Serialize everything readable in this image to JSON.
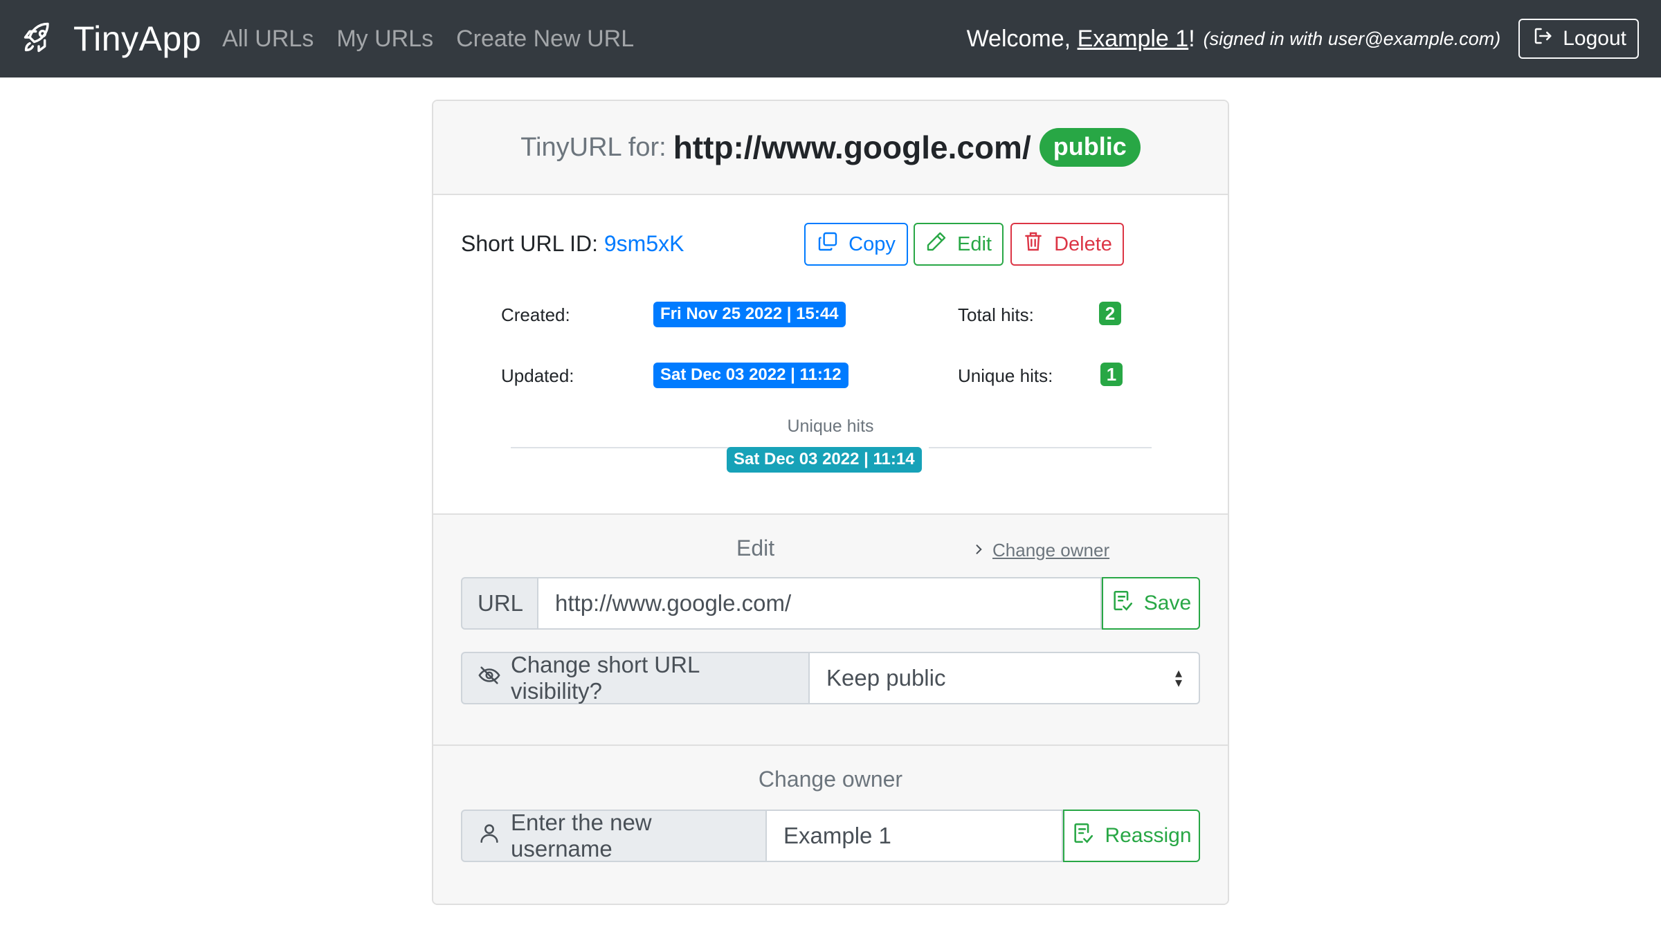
{
  "navbar": {
    "brand": "TinyApp",
    "brand_icon": "rocket-icon",
    "links": [
      "All URLs",
      "My URLs",
      "Create New URL"
    ],
    "welcome_prefix": "Welcome,",
    "username": "Example 1",
    "welcome_suffix": "!",
    "signed_in_as": "(signed in with user@example.com)",
    "logout_label": "Logout"
  },
  "card": {
    "header_label": "TinyURL for:",
    "long_url": "http://www.google.com/",
    "visibility_badge": "public",
    "short_id_label": "Short URL ID:",
    "short_id": "9sm5xK",
    "buttons": {
      "copy": "Copy",
      "edit": "Edit",
      "delete": "Delete"
    },
    "stats": {
      "created_label": "Created:",
      "created_value": "Fri Nov 25 2022 | 15:44",
      "updated_label": "Updated:",
      "updated_value": "Sat Dec 03 2022 | 11:12",
      "total_hits_label": "Total hits:",
      "total_hits": "2",
      "unique_hits_label": "Unique hits:",
      "unique_hits": "1",
      "unique_hits_caption": "Unique hits",
      "unique_hits_date": "Sat Dec 03 2022 | 11:14"
    },
    "edit": {
      "title": "Edit",
      "change_owner_link": "Change owner",
      "url_addon": "URL",
      "url_value": "http://www.google.com/",
      "save_label": "Save",
      "visibility_addon": "Change short URL visibility?",
      "visibility_selected": "Keep public"
    },
    "owner": {
      "title": "Change owner",
      "username_addon": "Enter the new username",
      "username_value": "Example 1",
      "reassign_label": "Reassign"
    }
  },
  "colors": {
    "navbar_bg": "#343a40",
    "primary": "#007bff",
    "success": "#28a745",
    "danger": "#dc3545",
    "info": "#17a2b8"
  }
}
